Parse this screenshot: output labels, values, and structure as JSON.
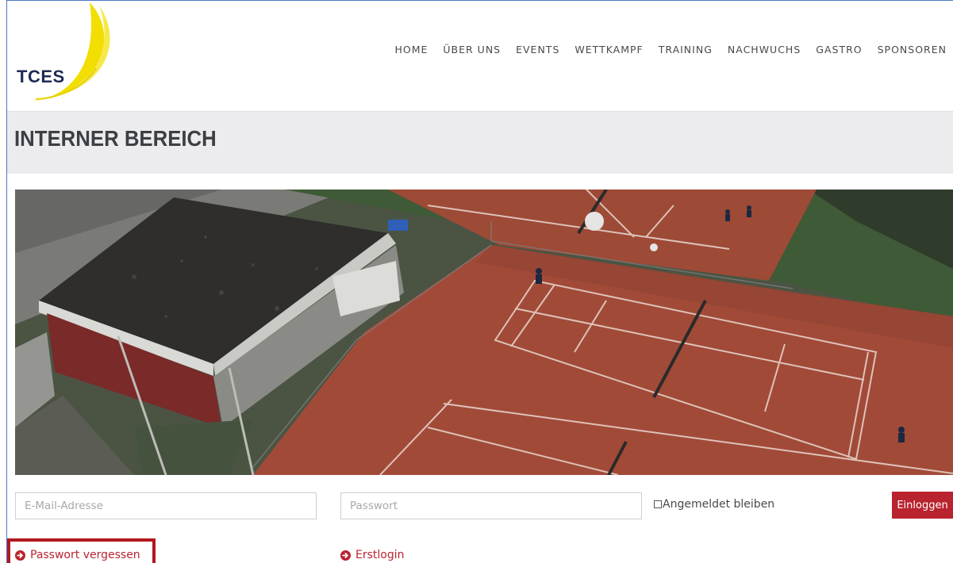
{
  "logo": {
    "text": "TCES",
    "icon": "tennis-ball-arc-logo",
    "accent_color": "#f2de00"
  },
  "nav": {
    "items": [
      "HOME",
      "ÜBER UNS",
      "EVENTS",
      "WETTKAMPF",
      "TRAINING",
      "NACHWUCHS",
      "GASTRO",
      "SPONSOREN"
    ]
  },
  "page": {
    "title": "INTERNER BEREICH"
  },
  "hero": {
    "image": "aerial-photo-of-clay-tennis-courts"
  },
  "form": {
    "email_placeholder": "E-Mail-Adresse",
    "password_placeholder": "Passwort",
    "remember_label": "Angemeldet bleiben",
    "login_button": "Einloggen"
  },
  "links": {
    "forgot_password": "Passwort vergessen",
    "first_login": "Erstlogin",
    "icon": "arrow-circle-right-icon"
  },
  "colors": {
    "brand_red": "#b9232f",
    "highlight_red": "#b11820",
    "title_bar_bg": "#ececee"
  }
}
